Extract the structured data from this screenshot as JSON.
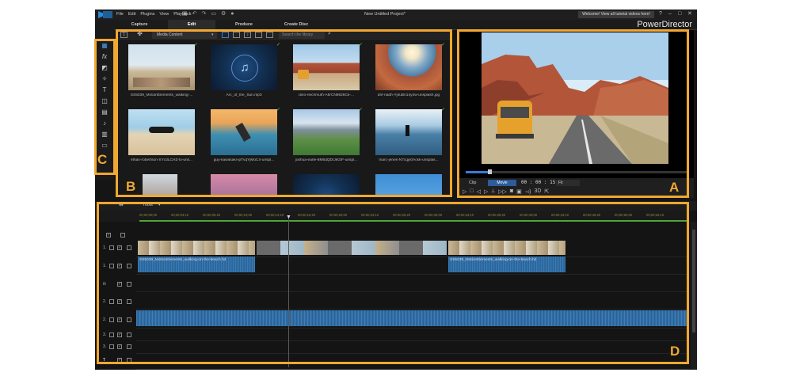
{
  "app": {
    "menu": [
      "File",
      "Edit",
      "Plugins",
      "View",
      "Playback"
    ],
    "project_title": "New Untitled Project*",
    "welcome": "Welcome! View all tutorial videos here!",
    "brand": "PowerDirector",
    "window_controls": [
      "?",
      "–",
      "□",
      "✕"
    ]
  },
  "modes": [
    {
      "label": "Capture"
    },
    {
      "label": "Edit"
    },
    {
      "label": "Produce"
    },
    {
      "label": "Create Disc"
    }
  ],
  "active_mode": "Edit",
  "library": {
    "media_filter": "Media Content",
    "search_placeholder": "Search the library",
    "items": [
      {
        "name": "SS5039_MotionElements_walking-...",
        "kind": "video",
        "checked": true
      },
      {
        "name": "Arc_of_the_Sun.mp3",
        "kind": "audio",
        "checked": true
      },
      {
        "name": "dino-reichmuth-A5rCN8626Ck-...",
        "kind": "image",
        "checked": true
      },
      {
        "name": "drif-riadh-Yj4uBn14y4w-unsplash.jpg",
        "kind": "image",
        "checked": true
      },
      {
        "name": "ethan-robertson-SYx3LCHZ-lo-uns...",
        "kind": "image",
        "checked": false
      },
      {
        "name": "guy-kawasaki-ipTvqYjMoC4-unspl...",
        "kind": "image",
        "checked": true
      },
      {
        "name": "joshua-earle-8M6dQDIJkGIF-unspl...",
        "kind": "image",
        "checked": true
      },
      {
        "name": "marc-jenes-N7cqjv0Ackk-unsplas...",
        "kind": "image",
        "checked": true
      }
    ]
  },
  "preview": {
    "mode_clip": "Clip",
    "mode_movie": "Movie",
    "timecode": "00 : 00 : 15 : 24",
    "fit": "Fit",
    "controls_3d": "3D"
  },
  "timeline": {
    "tools_label": "Tools",
    "ruler": [
      "00;00;00;00",
      "00;00;03;10",
      "00;00;06;20",
      "00;00;10;00",
      "00;00;13;10",
      "00;00;16;20",
      "00;00;20;00",
      "00;00;23;10",
      "00;00;26;20",
      "00;00;30;00",
      "00;00;33;10",
      "00;00;36;20",
      "00;00;40;00",
      "00;00;43;10",
      "00;00;46;20",
      "00;00;50;00",
      "00;00;53;10"
    ],
    "track_labels": [
      "1.",
      "1.",
      "fx",
      "2.",
      "2.",
      "3.",
      "3.",
      "T"
    ],
    "clip_caption": "SS5039_MotionElements_walking-on-the-beach.hd"
  },
  "callouts": [
    "A",
    "B",
    "C",
    "D"
  ],
  "colors": {
    "callout": "#f0a830",
    "accent": "#3a7bd5",
    "audio_wave": "#2f6ea6"
  }
}
